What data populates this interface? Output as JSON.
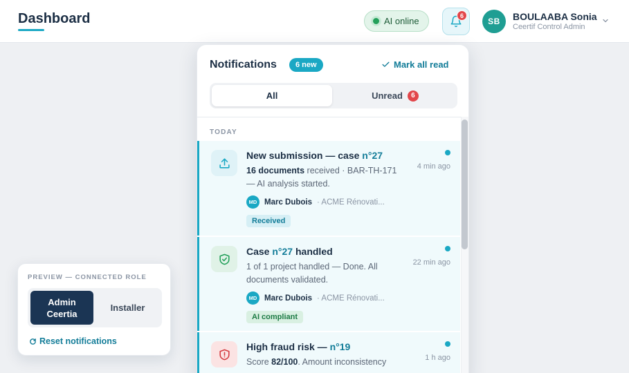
{
  "header": {
    "title": "Dashboard",
    "ai_status": "AI online",
    "notification_count": "6",
    "user": {
      "initials": "SB",
      "name": "BOULAABA Sonia",
      "role": "Ceertif Control Admin"
    }
  },
  "panel": {
    "title": "Notifications",
    "new_badge": "6 new",
    "mark_all_read": "Mark all read",
    "tabs": {
      "all": "All",
      "unread": "Unread",
      "unread_count": "6"
    },
    "section": "TODAY",
    "items": [
      {
        "title_pre": "New submission — case ",
        "title_hl": "n°27",
        "title_post": "",
        "body_bold": "16 documents",
        "body_rest": " received · BAR-TH-171 — AI analysis started.",
        "time": "4 min ago",
        "author_initials": "MD",
        "author_name": "Marc Dubois",
        "author_org": "· ACME Rénovati...",
        "tag": "Received",
        "icon": "upload-icon"
      },
      {
        "title_pre": "Case ",
        "title_hl": "n°27",
        "title_post": " handled",
        "body_bold": "",
        "body_rest": "1 of 1 project handled — Done. All documents validated.",
        "time": "22 min ago",
        "author_initials": "MD",
        "author_name": "Marc Dubois",
        "author_org": "· ACME Rénovati...",
        "tag": "AI compliant",
        "icon": "shield-check-icon"
      },
      {
        "title_pre": "High fraud risk — ",
        "title_hl": "n°19",
        "title_post": "",
        "body_pre": "Score ",
        "body_bold": "82/100",
        "body_rest": ". Amount inconsistency",
        "time": "1 h ago",
        "icon": "shield-alert-icon"
      }
    ]
  },
  "preview": {
    "label": "PREVIEW — CONNECTED ROLE",
    "role_admin_line1": "Admin",
    "role_admin_line2": "Ceertia",
    "role_installer": "Installer",
    "reset": "Reset notifications"
  },
  "colors": {
    "accent": "#1aa8c4",
    "danger": "#e2474b",
    "success": "#23a05a",
    "navy": "#1b3554"
  }
}
